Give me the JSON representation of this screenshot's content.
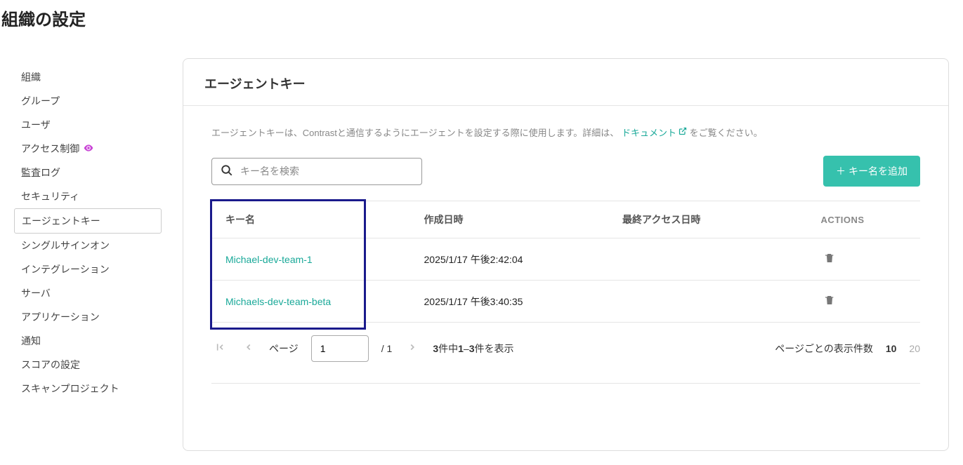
{
  "page": {
    "title": "組織の設定"
  },
  "sidebar": {
    "items": [
      {
        "label": "組織"
      },
      {
        "label": "グループ"
      },
      {
        "label": "ユーザ"
      },
      {
        "label": "アクセス制御",
        "hasEye": true
      },
      {
        "label": "監査ログ"
      },
      {
        "label": "セキュリティ"
      },
      {
        "label": "エージェントキー",
        "active": true
      },
      {
        "label": "シングルサインオン"
      },
      {
        "label": "インテグレーション"
      },
      {
        "label": "サーバ"
      },
      {
        "label": "アプリケーション"
      },
      {
        "label": "通知"
      },
      {
        "label": "スコアの設定"
      },
      {
        "label": "スキャンプロジェクト"
      }
    ]
  },
  "main": {
    "heading": "エージェントキー",
    "description_prefix": "エージェントキーは、Contrastと通信するようにエージェントを設定する際に使用します。詳細は、",
    "doc_link_label": "ドキュメント",
    "description_suffix": "をご覧ください。",
    "search_placeholder": "キー名を検索",
    "add_button_label": "キー名を追加"
  },
  "table": {
    "columns": {
      "key_name": "キー名",
      "created": "作成日時",
      "last_access": "最終アクセス日時",
      "actions": "ACTIONS"
    },
    "rows": [
      {
        "name": "Michael-dev-team-1",
        "created": "2025/1/17 午後2:42:04",
        "last_access": ""
      },
      {
        "name": "Michaels-dev-team-beta",
        "created": "2025/1/17 午後3:40:35",
        "last_access": ""
      }
    ]
  },
  "pagination": {
    "page_label": "ページ",
    "current_page": "1",
    "total_pages": "/ 1",
    "summary_total": "3",
    "summary_mid": "件中",
    "summary_from": "1",
    "summary_dash": "–",
    "summary_to": "3",
    "summary_suffix": "件を表示",
    "pagesize_label": "ページごとの表示件数",
    "pagesize_10": "10",
    "pagesize_20": "20"
  }
}
